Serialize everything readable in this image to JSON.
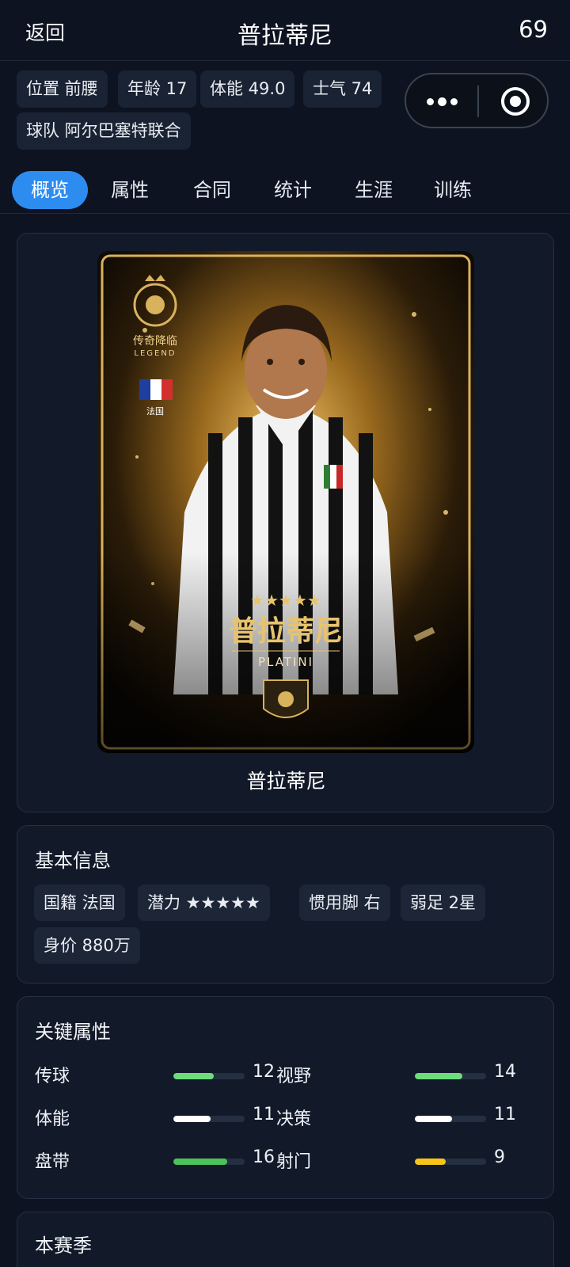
{
  "header": {
    "back_label": "返回",
    "title": "普拉蒂尼",
    "number": "69"
  },
  "chips": [
    {
      "label": "位置 前腰"
    },
    {
      "label": "年龄 17"
    },
    {
      "label": "体能 49.0"
    },
    {
      "label": "士气 74"
    },
    {
      "label": "球队 阿尔巴塞特联合"
    }
  ],
  "capsule": {
    "more_icon": "more-dots-icon",
    "close_icon": "target-circle-icon"
  },
  "tabs": [
    {
      "label": "概览",
      "active": true
    },
    {
      "label": "属性"
    },
    {
      "label": "合同"
    },
    {
      "label": "统计"
    },
    {
      "label": "生涯"
    },
    {
      "label": "训练"
    }
  ],
  "overview": {
    "player_name": "普拉蒂尼",
    "card_image": {
      "badge_text": "传奇降临",
      "badge_sub": "LEGEND",
      "flag_label": "法国",
      "stars": "★★★★★",
      "name_cn": "普拉蒂尼",
      "name_en": "PLATINI"
    }
  },
  "basic_info": {
    "title": "基本信息",
    "items": [
      {
        "label": "国籍 法国"
      },
      {
        "label": "潜力 ★★★★★"
      },
      {
        "label": "惯用脚 右"
      },
      {
        "label": "弱足 2星"
      },
      {
        "label": "身价 880万"
      }
    ]
  },
  "key_attributes": {
    "title": "关键属性",
    "max": 20,
    "rows": [
      {
        "left": {
          "label": "传球",
          "value": 12,
          "color": "#6edc7a"
        },
        "right": {
          "label": "视野",
          "value": 14,
          "color": "#6edc7a"
        }
      },
      {
        "left": {
          "label": "体能",
          "value": 11,
          "color": "#ffffff"
        },
        "right": {
          "label": "决策",
          "value": 11,
          "color": "#ffffff"
        }
      },
      {
        "left": {
          "label": "盘带",
          "value": 16,
          "color": "#4cc35a"
        },
        "right": {
          "label": "射门",
          "value": 9,
          "color": "#f5c518"
        }
      }
    ]
  },
  "season": {
    "title": "本赛季"
  }
}
